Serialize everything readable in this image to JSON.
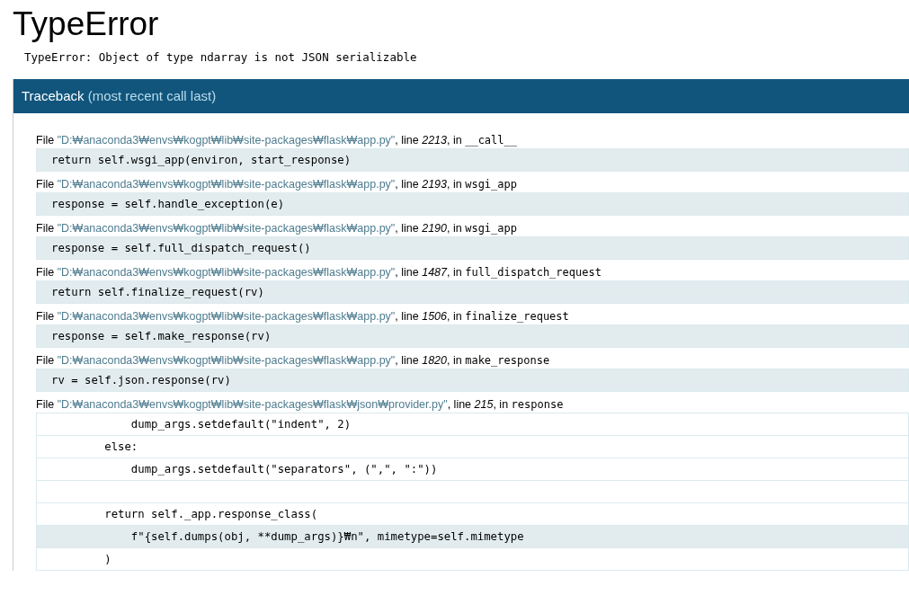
{
  "title": "TypeError",
  "message": "TypeError: Object of type ndarray is not JSON serializable",
  "traceback": {
    "heading": "Traceback",
    "note": "(most recent call last)",
    "frames": [
      {
        "file_label": "File",
        "path": "\"D:₩anaconda3₩envs₩kogpt₩lib₩site-packages₩flask₩app.py\"",
        "line_label": ", line",
        "line": "2213",
        "in_label": ", in",
        "function": "__call__",
        "source": [
          {
            "text": "return self.wsgi_app(environ, start_response)",
            "current": true
          }
        ]
      },
      {
        "file_label": "File",
        "path": "\"D:₩anaconda3₩envs₩kogpt₩lib₩site-packages₩flask₩app.py\"",
        "line_label": ", line",
        "line": "2193",
        "in_label": ", in",
        "function": "wsgi_app",
        "source": [
          {
            "text": "response = self.handle_exception(e)",
            "current": true
          }
        ]
      },
      {
        "file_label": "File",
        "path": "\"D:₩anaconda3₩envs₩kogpt₩lib₩site-packages₩flask₩app.py\"",
        "line_label": ", line",
        "line": "2190",
        "in_label": ", in",
        "function": "wsgi_app",
        "source": [
          {
            "text": "response = self.full_dispatch_request()",
            "current": true
          }
        ]
      },
      {
        "file_label": "File",
        "path": "\"D:₩anaconda3₩envs₩kogpt₩lib₩site-packages₩flask₩app.py\"",
        "line_label": ", line",
        "line": "1487",
        "in_label": ", in",
        "function": "full_dispatch_request",
        "source": [
          {
            "text": "return self.finalize_request(rv)",
            "current": true
          }
        ]
      },
      {
        "file_label": "File",
        "path": "\"D:₩anaconda3₩envs₩kogpt₩lib₩site-packages₩flask₩app.py\"",
        "line_label": ", line",
        "line": "1506",
        "in_label": ", in",
        "function": "finalize_request",
        "source": [
          {
            "text": "response = self.make_response(rv)",
            "current": true
          }
        ]
      },
      {
        "file_label": "File",
        "path": "\"D:₩anaconda3₩envs₩kogpt₩lib₩site-packages₩flask₩app.py\"",
        "line_label": ", line",
        "line": "1820",
        "in_label": ", in",
        "function": "make_response",
        "source": [
          {
            "text": "rv = self.json.response(rv)",
            "current": true
          }
        ]
      },
      {
        "file_label": "File",
        "path": "\"D:₩anaconda3₩envs₩kogpt₩lib₩site-packages₩flask₩json₩provider.py\"",
        "line_label": ", line",
        "line": "215",
        "in_label": ", in",
        "function": "response",
        "source": [
          {
            "text": "            dump_args.setdefault(\"indent\", 2)",
            "current": false
          },
          {
            "text": "        else:",
            "current": false
          },
          {
            "text": "            dump_args.setdefault(\"separators\", (\",\", \":\"))",
            "current": false
          },
          {
            "current": false
          },
          {
            "text": "        return self._app.response_class(",
            "current": false
          },
          {
            "text": "            f\"{self.dumps(obj, **dump_args)}₩n\", mimetype=self.mimetype",
            "current": true
          },
          {
            "text": "        )",
            "current": false
          }
        ]
      }
    ]
  }
}
